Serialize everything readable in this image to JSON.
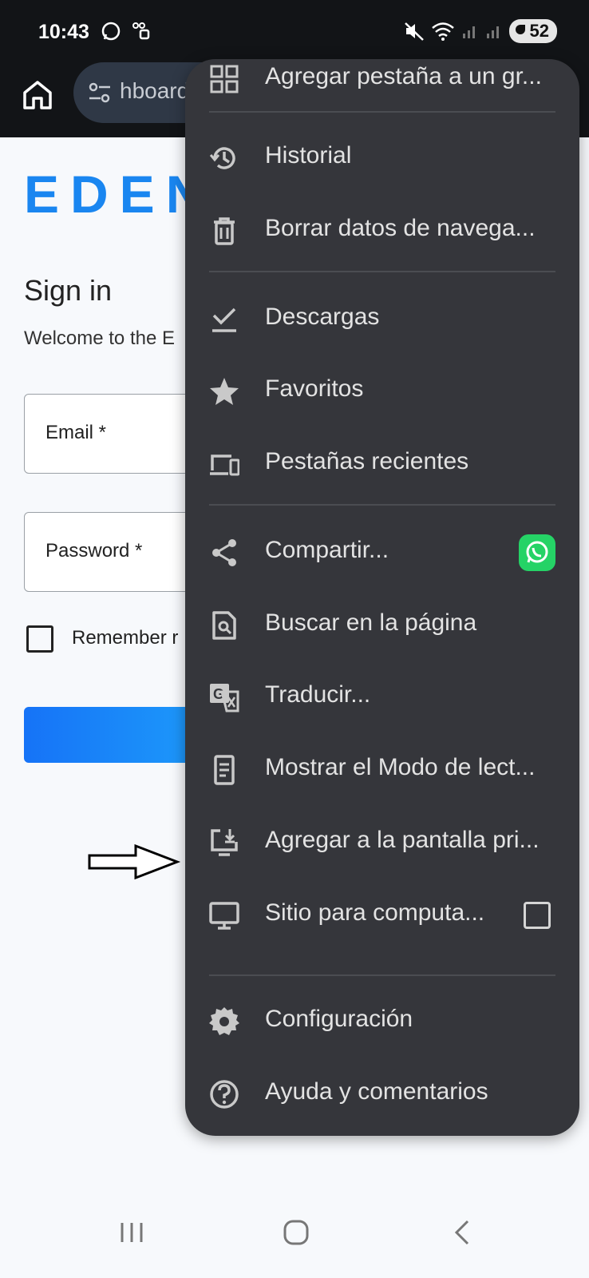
{
  "status_bar": {
    "time": "10:43",
    "battery": "52"
  },
  "browser": {
    "url_text": "hboard"
  },
  "page": {
    "logo": "EDEN",
    "title": "Sign in",
    "welcome": "Welcome to the E",
    "email_label": "Email *",
    "password_label": "Password *",
    "remember_label": "Remember r"
  },
  "menu": {
    "items": [
      {
        "label": "Agregar pestaña a un gr...",
        "icon": "tab-group-icon"
      },
      {
        "label": "Historial",
        "icon": "history-icon"
      },
      {
        "label": "Borrar datos de navega...",
        "icon": "trash-icon"
      },
      {
        "label": "Descargas",
        "icon": "download-check-icon"
      },
      {
        "label": "Favoritos",
        "icon": "star-icon"
      },
      {
        "label": "Pestañas recientes",
        "icon": "devices-icon"
      },
      {
        "label": "Compartir...",
        "icon": "share-icon"
      },
      {
        "label": "Buscar en la página",
        "icon": "find-in-page-icon"
      },
      {
        "label": "Traducir...",
        "icon": "translate-icon"
      },
      {
        "label": "Mostrar el Modo de lect...",
        "icon": "reader-mode-icon"
      },
      {
        "label": "Agregar a la pantalla pri...",
        "icon": "add-to-home-icon"
      },
      {
        "label": "Sitio para computa...",
        "icon": "desktop-icon"
      },
      {
        "label": "Configuración",
        "icon": "settings-icon"
      },
      {
        "label": "Ayuda y comentarios",
        "icon": "help-icon"
      }
    ],
    "share_app": "whatsapp-icon",
    "desktop_site_checked": false
  },
  "colors": {
    "menu_bg": "#35363b",
    "toolbar_bg": "#121417",
    "accent": "#1a86f0",
    "whatsapp": "#25d366"
  }
}
